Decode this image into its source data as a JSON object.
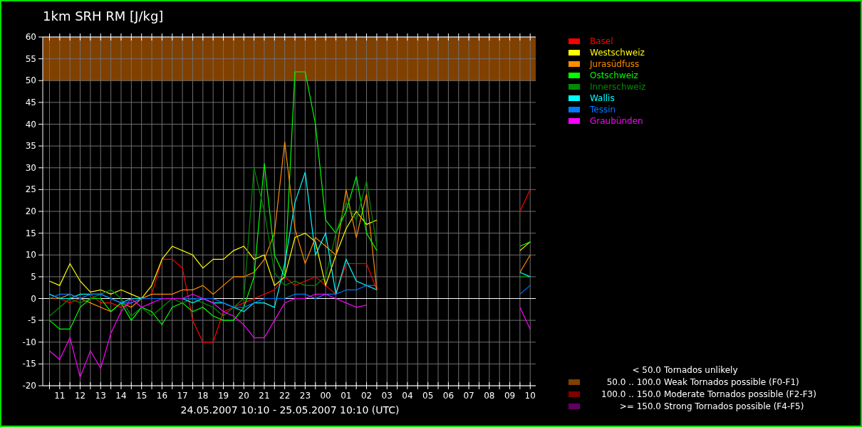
{
  "title": "1km SRH RM [J/kg]",
  "chart_data": {
    "type": "line",
    "ylim": [
      -20,
      60
    ],
    "yticks": [
      -20,
      -15,
      -10,
      -5,
      0,
      5,
      10,
      15,
      20,
      25,
      30,
      35,
      40,
      45,
      50,
      55,
      60
    ],
    "categories": [
      null,
      "11",
      null,
      "12",
      null,
      "13",
      null,
      "14",
      null,
      "15",
      null,
      "16",
      null,
      "17",
      null,
      "18",
      null,
      "19",
      null,
      "20",
      null,
      "21",
      null,
      "22",
      null,
      "23",
      null,
      "00",
      null,
      "01",
      null,
      "02",
      null,
      "03",
      null,
      "04",
      null,
      "05",
      null,
      "06",
      null,
      "07",
      null,
      "08",
      null,
      "09",
      null,
      "10"
    ],
    "grid": true,
    "bands": [
      {
        "axis": "y",
        "from": 50,
        "to": 60,
        "color": "#804000"
      }
    ],
    "series": [
      {
        "name": "Basel",
        "color": "#ff0000",
        "values": [
          0,
          0,
          -1,
          0,
          1,
          -1,
          -1,
          -2,
          -1,
          0,
          1,
          9,
          9,
          7,
          -5,
          -10,
          -10,
          -3,
          -2,
          -1,
          0,
          1,
          2,
          5,
          3,
          4,
          5,
          3,
          1,
          8,
          8,
          8,
          2,
          null,
          null,
          null,
          null,
          null,
          null,
          null,
          null,
          null,
          null,
          null,
          null,
          null,
          20,
          25
        ]
      },
      {
        "name": "Westschweiz",
        "color": "#ffff00",
        "values": [
          4,
          3,
          8,
          4,
          1.5,
          2,
          1,
          2,
          1,
          0,
          3,
          9,
          12,
          11,
          10,
          7,
          9,
          9,
          11,
          12,
          9,
          10,
          3,
          5,
          14,
          15,
          13,
          3,
          10,
          16,
          20,
          17,
          18,
          null,
          null,
          null,
          null,
          null,
          null,
          null,
          null,
          null,
          null,
          null,
          null,
          null,
          11,
          13
        ]
      },
      {
        "name": "Jurasüdfuss",
        "color": "#ff8c00",
        "values": [
          0,
          0,
          1,
          0,
          -1,
          -2,
          -3,
          -1,
          -2,
          0,
          1,
          1,
          1,
          2,
          2,
          3,
          1,
          3,
          5,
          5,
          6,
          9,
          15,
          36,
          16,
          8,
          14,
          12,
          10,
          25,
          14,
          24,
          2,
          null,
          null,
          null,
          null,
          null,
          null,
          null,
          null,
          null,
          null,
          null,
          null,
          null,
          6,
          10
        ]
      },
      {
        "name": "Ostschweiz",
        "color": "#00ff00",
        "values": [
          -5,
          -7,
          -7,
          -2,
          0,
          0,
          -3,
          -1,
          -5,
          -2,
          -3,
          -6,
          -2,
          -1,
          -3,
          -2,
          -4,
          -5,
          -5,
          -2,
          5,
          31,
          10,
          5,
          52,
          52,
          40,
          18,
          15,
          20,
          28,
          15,
          11,
          null,
          null,
          null,
          null,
          null,
          null,
          null,
          null,
          null,
          null,
          null,
          null,
          null,
          12,
          13
        ]
      },
      {
        "name": "Innerschweiz",
        "color": "#008c00",
        "values": [
          -4,
          -2,
          0,
          -1,
          0,
          1,
          2,
          0,
          -4,
          -2,
          -4,
          -2,
          0,
          -1,
          0,
          -1,
          -2,
          -4,
          -2,
          0,
          30,
          20,
          6,
          3,
          4,
          3,
          3,
          5,
          15,
          22,
          18,
          27,
          12,
          null,
          null,
          null,
          null,
          null,
          null,
          null,
          null,
          null,
          null,
          null,
          null,
          null,
          5,
          5
        ]
      },
      {
        "name": "Wallis",
        "color": "#00ffff",
        "values": [
          1,
          0,
          0,
          1,
          1,
          1,
          0,
          -1,
          0,
          0,
          0,
          0,
          0,
          0,
          -1,
          0,
          -1,
          -1,
          -2,
          -3,
          -1,
          -1,
          -2,
          8,
          22,
          29,
          10,
          15,
          1,
          9,
          4,
          3,
          2,
          null,
          null,
          null,
          null,
          null,
          null,
          null,
          null,
          null,
          null,
          null,
          null,
          null,
          6,
          5
        ]
      },
      {
        "name": "Tessin",
        "color": "#0078ff",
        "values": [
          0,
          1,
          1,
          0,
          1,
          1,
          0,
          -1,
          -1,
          0,
          0,
          0,
          0,
          0,
          0,
          0,
          0,
          -1,
          -2,
          -2,
          -1,
          0,
          0,
          0,
          1,
          1,
          0,
          1,
          1,
          2,
          2,
          3,
          3,
          null,
          null,
          null,
          null,
          null,
          null,
          null,
          null,
          null,
          null,
          null,
          null,
          null,
          1,
          3
        ]
      },
      {
        "name": "Graubünden",
        "color": "#ff00ff",
        "values": [
          -12,
          -14,
          -9,
          -18,
          -12,
          -16,
          -8,
          -3,
          0,
          -2,
          -1,
          0,
          0,
          0,
          1,
          0,
          -1,
          -3,
          -4,
          -6,
          -9,
          -9,
          -5,
          -1,
          0,
          0,
          1,
          1,
          0,
          -1,
          -2,
          -1.5,
          null,
          null,
          null,
          null,
          null,
          null,
          null,
          null,
          null,
          null,
          null,
          null,
          null,
          null,
          -2,
          -7
        ]
      }
    ]
  },
  "time_range": "24.05.2007 10:10 - 25.05.2007 10:10  (UTC)",
  "risk_legend": [
    {
      "range": "< 50.0",
      "text": "Tornados unlikely"
    },
    {
      "range": "50.0 .. 100.0",
      "text": "Weak Tornados possible (F0-F1)",
      "color": "#804000"
    },
    {
      "range": "100.0 .. 150.0",
      "text": "Moderate Tornados possible (F2-F3)",
      "color": "#800000"
    },
    {
      "range": ">= 150.0",
      "text": "Strong Tornados possible (F4-F5)",
      "color": "#600060"
    }
  ]
}
